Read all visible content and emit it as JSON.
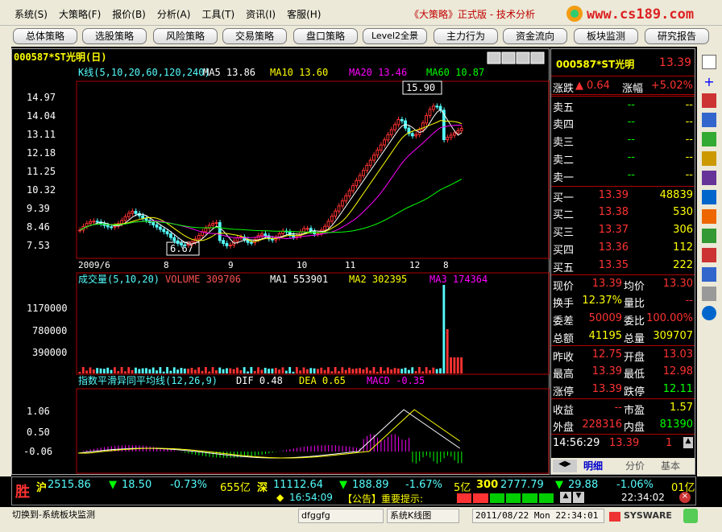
{
  "menu": {
    "items": [
      "系统(S)",
      "大策略(F)",
      "报价(B)",
      "分析(A)",
      "工具(T)",
      "资讯(I)",
      "客服(H)"
    ],
    "app_title": "《大策略》正式版 - 技术分析",
    "logo_text": "www.cs189.com"
  },
  "strategy_buttons": [
    "总体策略",
    "选股策略",
    "风险策略",
    "交易策略",
    "盘口策略",
    "Level2全景",
    "主力行为",
    "资金流向",
    "板块监测",
    "研究报告"
  ],
  "chart": {
    "title": "000587*ST光明(日)",
    "kline_legend": {
      "label": "K线(5,10,20,60,120,240)",
      "ma5": "MA5 13.86",
      "ma10": "MA10 13.60",
      "ma20": "MA20 13.46",
      "ma60": "MA60 10.87"
    },
    "price_axis": [
      "14.97",
      "14.04",
      "13.11",
      "12.18",
      "11.25",
      "10.32",
      "9.39",
      "8.46",
      "7.53"
    ],
    "date_axis": [
      "2009/6",
      "8",
      "9",
      "10",
      "11",
      "12",
      "8"
    ],
    "high_label": "15.90",
    "low_label": "6.67",
    "volume_legend": {
      "label": "成交量(5,10,20)",
      "volume": "VOLUME 309706",
      "ma1": "MA1 553901",
      "ma2": "MA2 302395",
      "ma3": "MA3 174364"
    },
    "volume_axis": [
      "1170000",
      "780000",
      "390000"
    ],
    "macd_legend": {
      "label": "指数平滑异同平均线(12,26,9)",
      "dif": "DIF 0.48",
      "dea": "DEA 0.65",
      "macd": "MACD -0.35"
    },
    "macd_axis": [
      "1.06",
      "0.50",
      "-0.06"
    ],
    "colors": {
      "up": "#ff3232",
      "down": "#54fcfc",
      "ma5": "#ffffff",
      "ma10": "#ffff00",
      "ma20": "#ff00ff",
      "ma60": "#00ff00"
    }
  },
  "quote": {
    "code_name": "000587*ST光明",
    "price": "13.39",
    "change_label": "涨跌",
    "change": "0.64",
    "pct_label": "涨幅",
    "pct": "+5.02%",
    "asks": [
      {
        "label": "卖五",
        "price": "--",
        "vol": "--"
      },
      {
        "label": "卖四",
        "price": "--",
        "vol": "--"
      },
      {
        "label": "卖三",
        "price": "--",
        "vol": "--"
      },
      {
        "label": "卖二",
        "price": "--",
        "vol": "--"
      },
      {
        "label": "卖一",
        "price": "--",
        "vol": "--"
      }
    ],
    "bids": [
      {
        "label": "买一",
        "price": "13.39",
        "vol": "48839"
      },
      {
        "label": "买二",
        "price": "13.38",
        "vol": "530"
      },
      {
        "label": "买三",
        "price": "13.37",
        "vol": "306"
      },
      {
        "label": "买四",
        "price": "13.36",
        "vol": "112"
      },
      {
        "label": "买五",
        "price": "13.35",
        "vol": "222"
      }
    ],
    "stats": [
      {
        "l1": "现价",
        "v1": "13.39",
        "l2": "均价",
        "v2": "13.30"
      },
      {
        "l1": "换手",
        "v1": "12.37%",
        "l2": "量比",
        "v2": "--"
      },
      {
        "l1": "委差",
        "v1": "50009",
        "l2": "委比",
        "v2": "100.00%"
      },
      {
        "l1": "总额",
        "v1": "41195",
        "l2": "总量",
        "v2": "309707"
      }
    ],
    "stats2": [
      {
        "l1": "昨收",
        "v1": "12.75",
        "l2": "开盘",
        "v2": "13.03"
      },
      {
        "l1": "最高",
        "v1": "13.39",
        "l2": "最低",
        "v2": "12.98"
      },
      {
        "l1": "涨停",
        "v1": "13.39",
        "l2": "跌停",
        "v2": "12.11"
      }
    ],
    "stats3": [
      {
        "l1": "收益",
        "v1": "--",
        "l2": "市盈",
        "v2": "1.57"
      },
      {
        "l1": "外盘",
        "v1": "228316",
        "l2": "内盘",
        "v2": "81390"
      }
    ],
    "tick": {
      "time": "14:56:29",
      "price": "13.39",
      "vol": "1"
    },
    "tabs": [
      "明细",
      "分价",
      "基本"
    ]
  },
  "status": {
    "logo": "胜",
    "sh": {
      "label": "沪",
      "index": "2515.86",
      "chg": "18.50",
      "pct": "-0.73%",
      "amt": "655亿"
    },
    "sz": {
      "label": "深",
      "index": "11112.64",
      "chg": "188.89",
      "pct": "-1.67%",
      "amt": "5亿"
    },
    "hs300": {
      "label": "300",
      "index": "2777.79",
      "chg": "29.88",
      "pct": "-1.06%",
      "amt": "01亿"
    },
    "time": "16:54:09",
    "notice": "【公告】重要提示:",
    "clock2": "22:34:02"
  },
  "bottom": {
    "hint": "切换到-系统板块监测",
    "input": "dfggfg",
    "line": "系统K线图",
    "datetime": "2011/08/22 Mon 22:34:01",
    "brand": "SYSWARE"
  }
}
